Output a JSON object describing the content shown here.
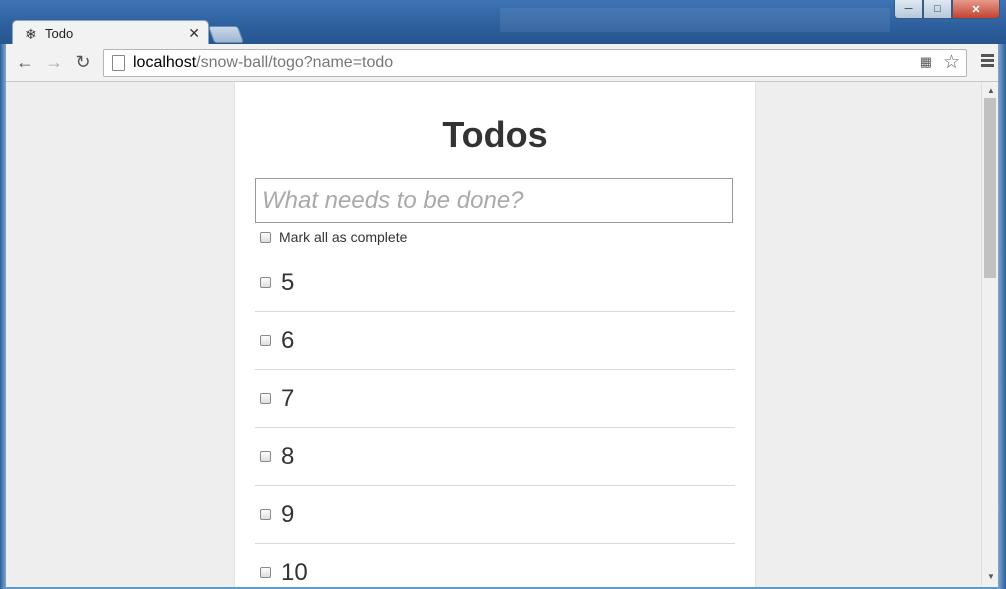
{
  "browser": {
    "tab": {
      "title": "Todo",
      "favicon": "snowflake-icon"
    },
    "url": {
      "host": "localhost",
      "path": "/snow-ball/togo?name=todo"
    }
  },
  "app": {
    "heading": "Todos",
    "new_todo_placeholder": "What needs to be done?",
    "mark_all_label": "Mark all as complete",
    "todos": [
      {
        "label": "5",
        "completed": false
      },
      {
        "label": "6",
        "completed": false
      },
      {
        "label": "7",
        "completed": false
      },
      {
        "label": "8",
        "completed": false
      },
      {
        "label": "9",
        "completed": false
      },
      {
        "label": "10",
        "completed": false
      }
    ]
  }
}
